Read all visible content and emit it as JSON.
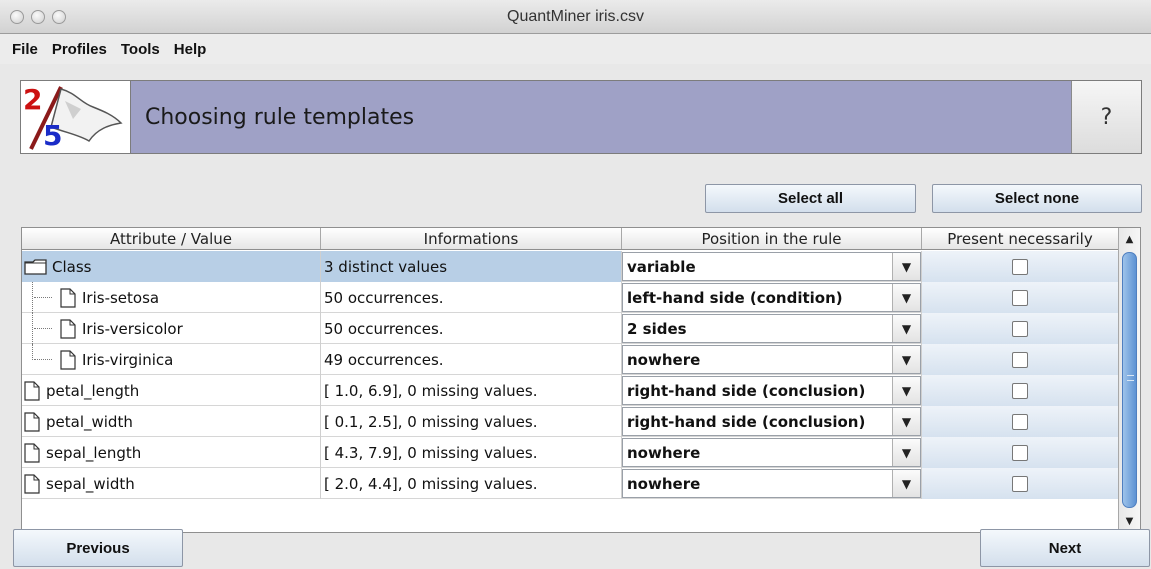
{
  "window": {
    "title": "QuantMiner iris.csv"
  },
  "menu": {
    "items": [
      "File",
      "Profiles",
      "Tools",
      "Help"
    ]
  },
  "header": {
    "title": "Choosing rule templates",
    "help_label": "?",
    "logo_digits": [
      "2",
      "5"
    ]
  },
  "actions": {
    "select_all": "Select all",
    "select_none": "Select none"
  },
  "table": {
    "columns": [
      "Attribute / Value",
      "Informations",
      "Position in the rule",
      "Present necessarily"
    ],
    "rows": [
      {
        "attribute": "Class",
        "info": "3 distinct values",
        "position": "variable",
        "present": false
      },
      {
        "attribute": "Iris-setosa",
        "info": "50 occurrences.",
        "position": "left-hand side (condition)",
        "present": false
      },
      {
        "attribute": "Iris-versicolor",
        "info": "50 occurrences.",
        "position": "2 sides",
        "present": false
      },
      {
        "attribute": "Iris-virginica",
        "info": "49 occurrences.",
        "position": "nowhere",
        "present": false
      },
      {
        "attribute": "petal_length",
        "info": "[ 1.0, 6.9],  0 missing values.",
        "position": "right-hand side (conclusion)",
        "present": false
      },
      {
        "attribute": "petal_width",
        "info": "[ 0.1, 2.5],  0 missing values.",
        "position": "right-hand side (conclusion)",
        "present": false
      },
      {
        "attribute": "sepal_length",
        "info": "[ 4.3, 7.9],  0 missing values.",
        "position": "nowhere",
        "present": false
      },
      {
        "attribute": "sepal_width",
        "info": "[ 2.0, 4.4],  0 missing values.",
        "position": "nowhere",
        "present": false
      }
    ]
  },
  "footer": {
    "previous": "Previous",
    "next": "Next"
  },
  "colors": {
    "banner": "#9fa1c6",
    "selection": "#b8cfe6",
    "scroll_thumb": "#5d92d3"
  }
}
